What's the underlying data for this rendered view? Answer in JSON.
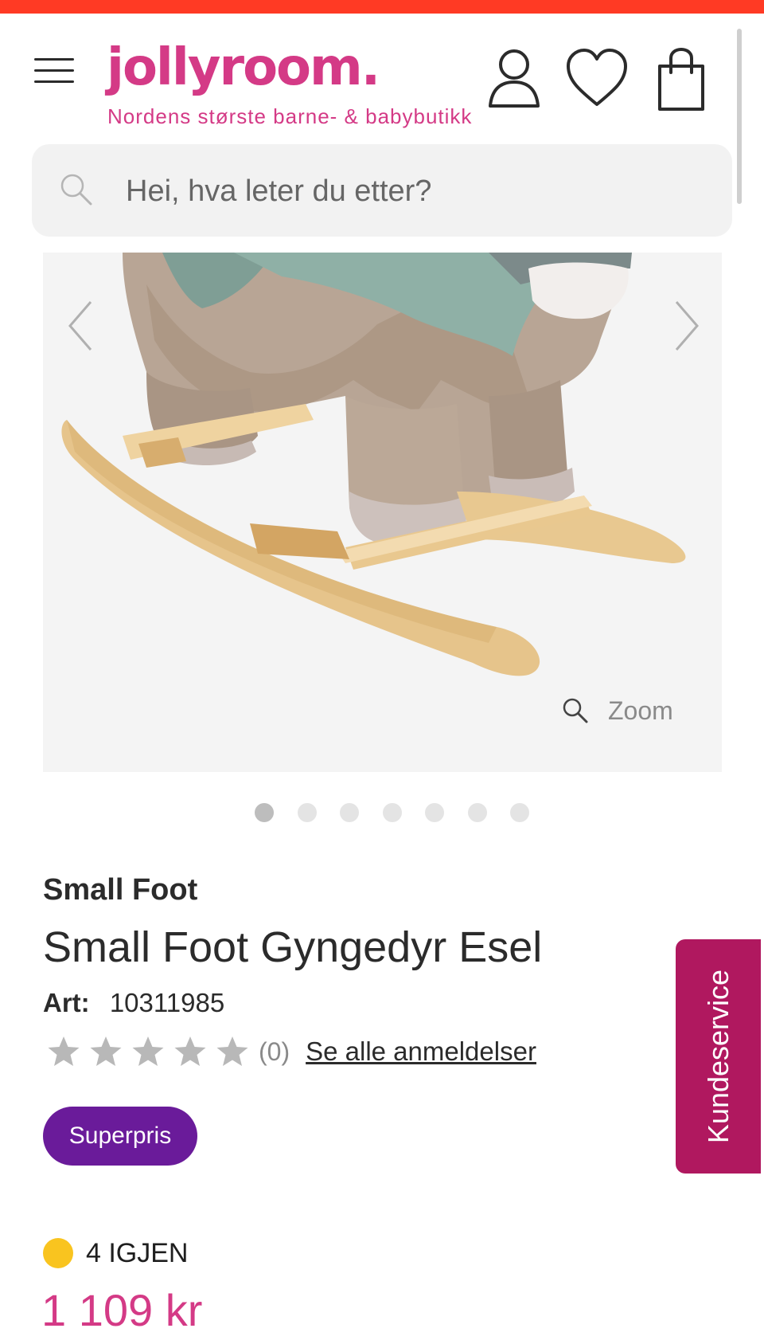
{
  "colors": {
    "top_strip": "#ff3a24",
    "brand_pink": "#d43a86",
    "badge_purple": "#6a1b9a",
    "kundeservice_bg": "#b0185f",
    "stock_dot": "#f9c41f"
  },
  "header": {
    "logo": "jollyroom.",
    "tagline": "Nordens største barne- & babybutikk",
    "icons": [
      "menu-icon",
      "user-icon",
      "heart-icon",
      "bag-icon"
    ]
  },
  "search": {
    "placeholder": "Hei, hva leter du etter?",
    "icon": "search-icon"
  },
  "gallery": {
    "zoom_label": "Zoom",
    "image_count": 7,
    "active_index": 0
  },
  "product": {
    "brand": "Small Foot",
    "title": "Small Foot Gyngedyr Esel",
    "art_label": "Art:",
    "art_number": "10311985",
    "rating": 0,
    "rating_max": 5,
    "review_count": "(0)",
    "review_link": "Se alle anmeldelser",
    "badge": "Superpris",
    "stock_text": "4 IGJEN",
    "price": "1 109 kr"
  },
  "floating": {
    "kundeservice": "Kundeservice"
  }
}
